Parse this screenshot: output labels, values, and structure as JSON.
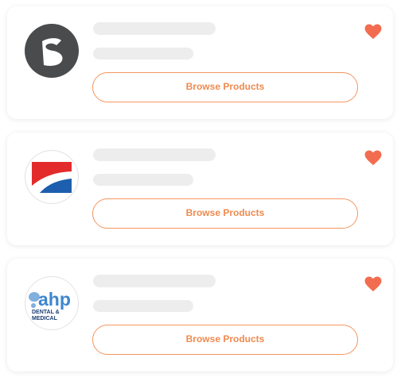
{
  "colors": {
    "accent": "#f07a4a",
    "heart": "#f26d4f",
    "skeleton": "#ededed"
  },
  "cards": [
    {
      "logo_icon": "sendle-s-logo-icon",
      "button_label": "Browse Products",
      "favorite_icon": "heart-icon"
    },
    {
      "logo_icon": "red-white-blue-flag-logo-icon",
      "button_label": "Browse Products",
      "favorite_icon": "heart-icon"
    },
    {
      "logo_icon": "ahp-dental-medical-logo-icon",
      "logo_text": "ahp",
      "logo_subtext_1": "DENTAL &",
      "logo_subtext_2": "MEDICAL",
      "button_label": "Browse Products",
      "favorite_icon": "heart-icon"
    }
  ]
}
